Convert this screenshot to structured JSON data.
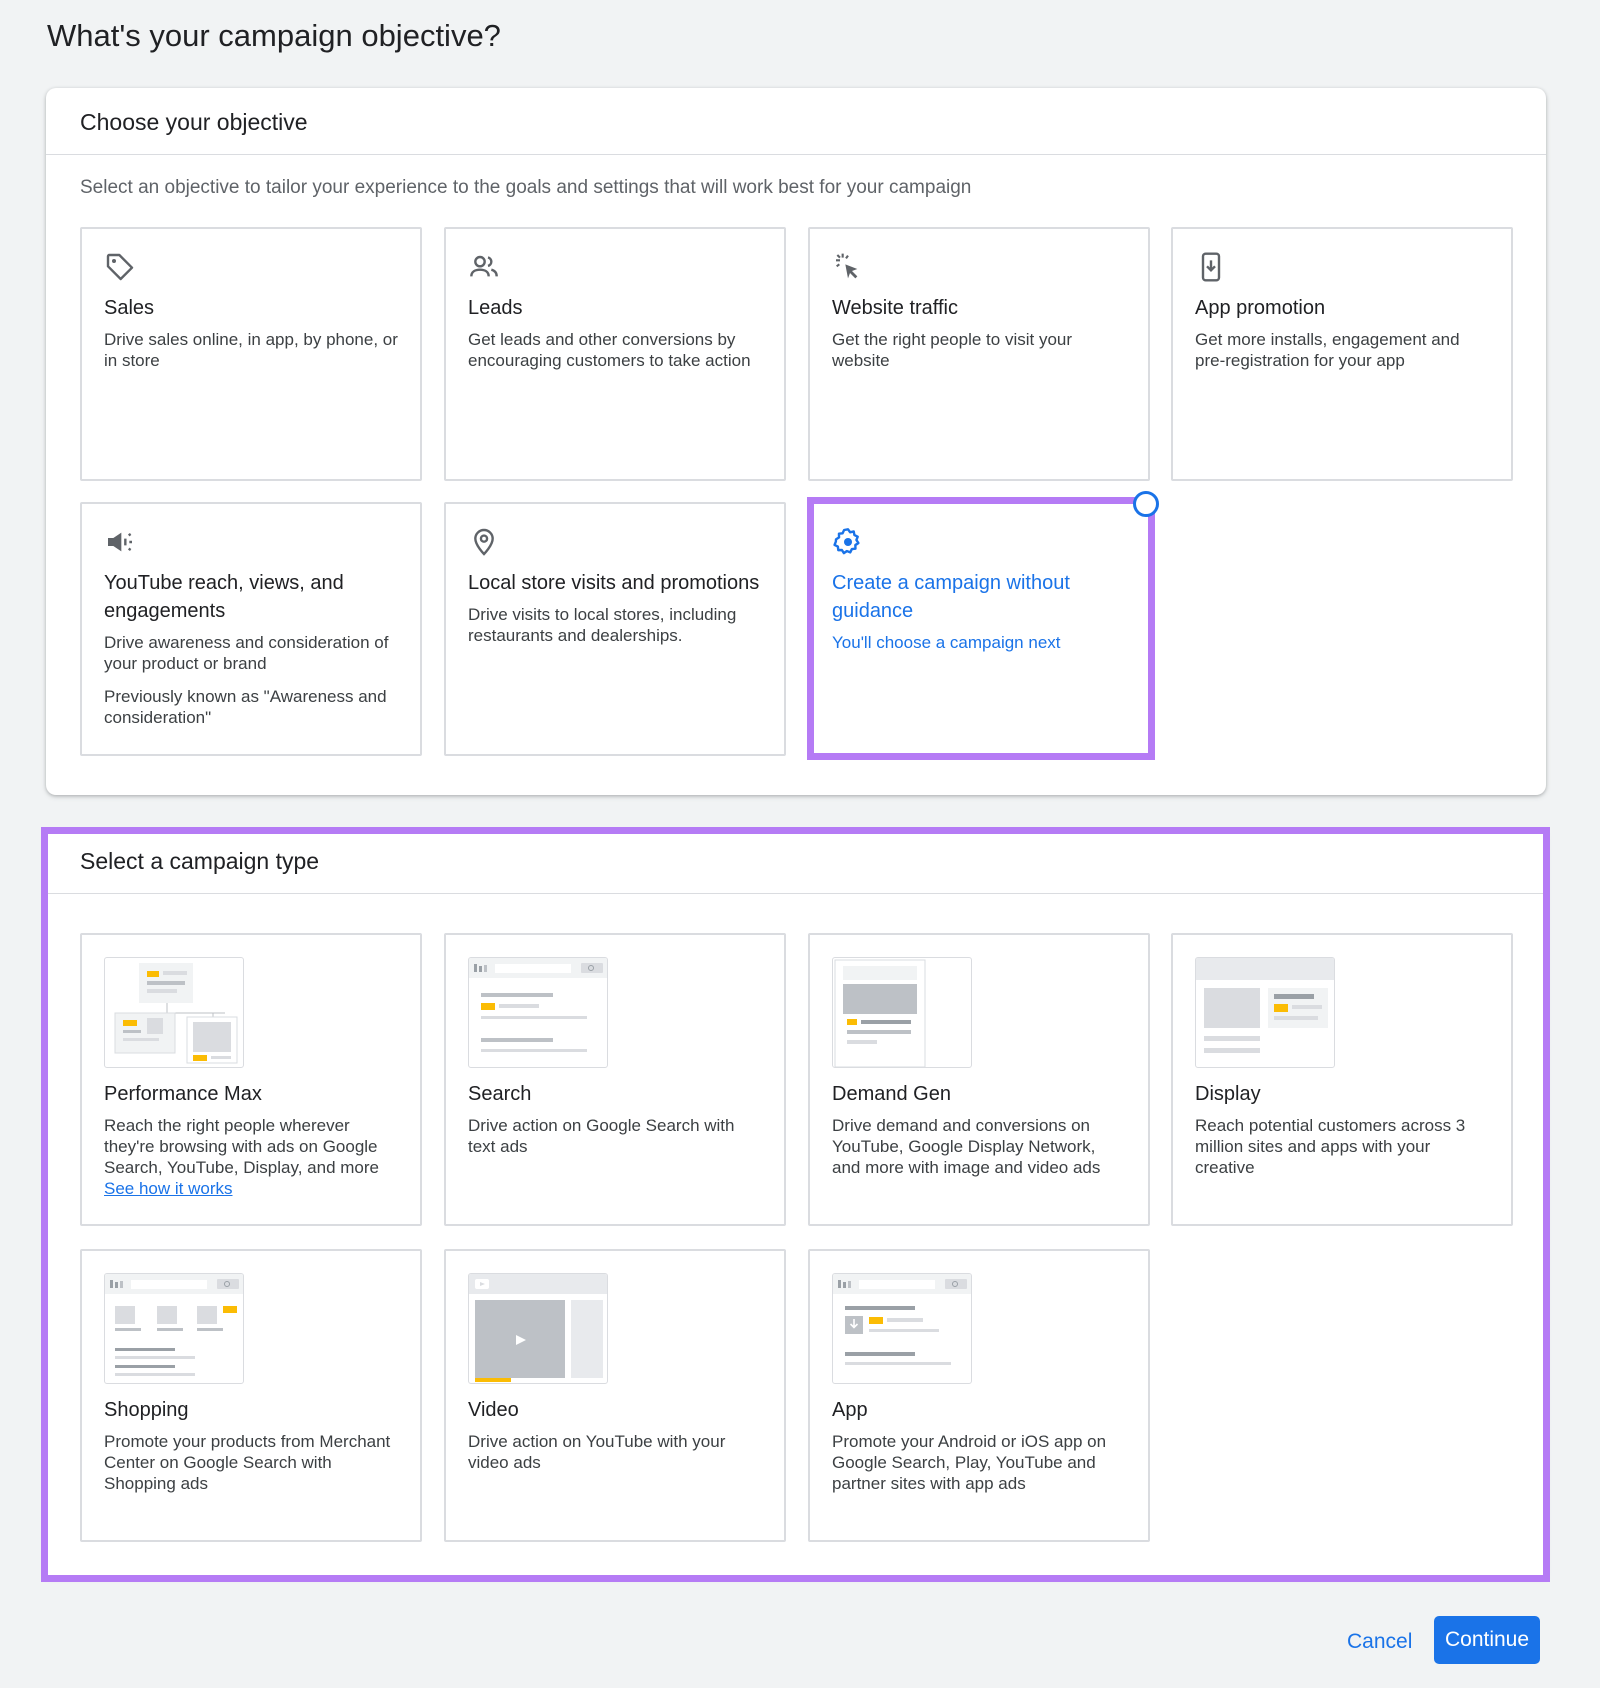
{
  "page": {
    "title": "What's your campaign objective?"
  },
  "objective": {
    "header": "Choose your objective",
    "subtitle": "Select an objective to tailor your experience to the goals and settings that will work best for your campaign",
    "cards": [
      {
        "icon": "tag-icon",
        "title": "Sales",
        "desc": "Drive sales online, in app, by phone, or in store"
      },
      {
        "icon": "people-icon",
        "title": "Leads",
        "desc": "Get leads and other conversions by encouraging customers to take action"
      },
      {
        "icon": "cursor-click-icon",
        "title": "Website traffic",
        "desc": "Get the right people to visit your website"
      },
      {
        "icon": "phone-download-icon",
        "title": "App promotion",
        "desc": "Get more installs, engagement and pre-registration for your app"
      },
      {
        "icon": "megaphone-icon",
        "title": "YouTube reach, views, and engagements",
        "desc": "Drive awareness and consideration of your product or brand",
        "extra": "Previously known as \"Awareness and consideration\""
      },
      {
        "icon": "location-pin-icon",
        "title": "Local store visits and promotions",
        "desc": "Drive visits to local stores, including restaurants and dealerships."
      },
      {
        "icon": "gear-icon",
        "title": "Create a campaign without guidance",
        "desc": "You'll choose a campaign next",
        "selected": true
      }
    ]
  },
  "campaign_type": {
    "header": "Select a campaign type",
    "cards": [
      {
        "title": "Performance Max",
        "desc": "Reach the right people wherever they're browsing with ads on Google Search, YouTube, Display, and more",
        "link": "See how it works"
      },
      {
        "title": "Search",
        "desc": "Drive action on Google Search with text ads"
      },
      {
        "title": "Demand Gen",
        "desc": "Drive demand and conversions on YouTube, Google Display Network, and more with image and video ads"
      },
      {
        "title": "Display",
        "desc": "Reach potential customers across 3 million sites and apps with your creative"
      },
      {
        "title": "Shopping",
        "desc": "Promote your products from Merchant Center on Google Search with Shopping ads"
      },
      {
        "title": "Video",
        "desc": "Drive action on YouTube with your video ads"
      },
      {
        "title": "App",
        "desc": "Promote your Android or iOS app on Google Search, Play, YouTube and partner sites with app ads"
      }
    ]
  },
  "footer": {
    "cancel": "Cancel",
    "continue": "Continue"
  },
  "colors": {
    "accent": "#1a73e8",
    "highlight": "#b57bf5",
    "thumb_accent": "#fbbc04"
  }
}
